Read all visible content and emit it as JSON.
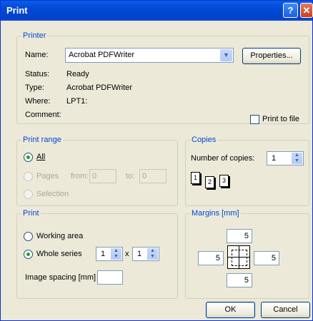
{
  "window": {
    "title": "Print"
  },
  "printer": {
    "group_label": "Printer",
    "name_label": "Name:",
    "name_value": "Acrobat PDFWriter",
    "properties_button": "Properties...",
    "status_label": "Status:",
    "status_value": "Ready",
    "type_label": "Type:",
    "type_value": "Acrobat PDFWriter",
    "where_label": "Where:",
    "where_value": "LPT1:",
    "comment_label": "Comment:",
    "print_to_file_label": "Print to file"
  },
  "print_range": {
    "group_label": "Print range",
    "all_label": "All",
    "pages_label": "Pages",
    "from_label": "from:",
    "from_value": "0",
    "to_label": "to:",
    "to_value": "0",
    "selection_label": "Selection",
    "selected": "all"
  },
  "copies": {
    "group_label": "Copies",
    "number_label": "Number of copies:",
    "number_value": "1",
    "collate_pages": [
      "1",
      "2",
      "3"
    ]
  },
  "print": {
    "group_label": "Print",
    "working_area_label": "Working area",
    "whole_series_label": "Whole series",
    "series_rows": "1",
    "series_x": "x",
    "series_cols": "1",
    "image_spacing_label": "Image spacing [mm]",
    "image_spacing_value": "",
    "selected": "whole_series"
  },
  "margins": {
    "group_label": "Margins [mm]",
    "top": "5",
    "left": "5",
    "right": "5",
    "bottom": "5"
  },
  "buttons": {
    "ok": "OK",
    "cancel": "Cancel"
  },
  "colors": {
    "title_bar": "#0349d8",
    "accent_label": "#0046d5",
    "dialog_bg": "#ece9d8"
  }
}
